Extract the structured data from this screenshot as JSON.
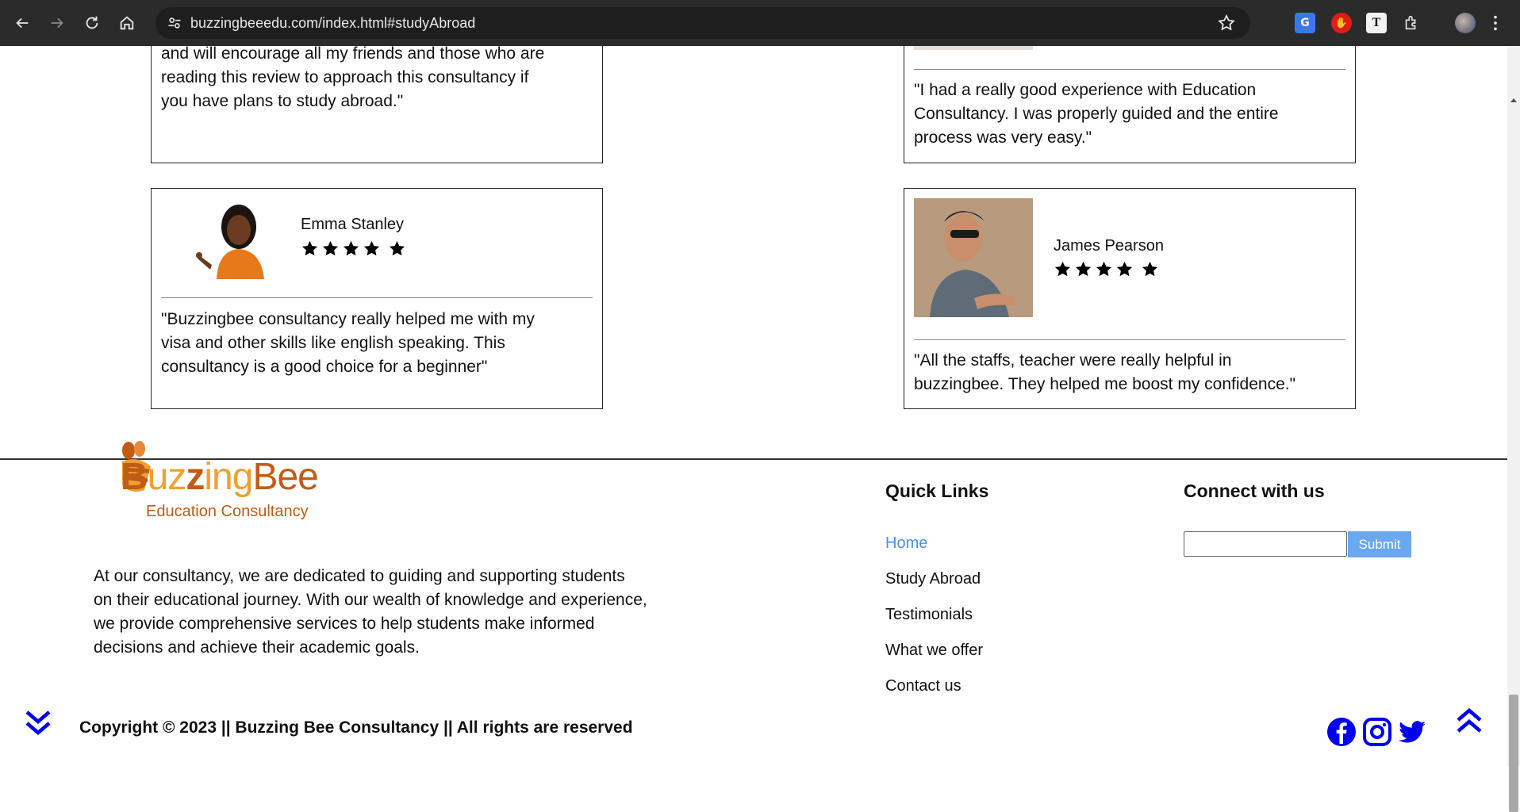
{
  "browser": {
    "url": "buzzingbeeedu.com/index.html#studyAbroad"
  },
  "testimonials": {
    "top_left_quote": [
      "and will encourage all my friends and those who are",
      "reading this review to approach this consultancy if",
      "you have plans to study abroad.\""
    ],
    "top_right_quote": [
      "\"I had a really good experience with Education",
      "Consultancy. I was properly guided and the entire",
      "process was very easy.\""
    ],
    "emma": {
      "name": "Emma Stanley",
      "quote": [
        "\"Buzzingbee consultancy really helped me with my",
        "visa and other skills like english speaking. This",
        "consultancy is a good choice for a beginner\""
      ],
      "rating": 5
    },
    "james": {
      "name": "James Pearson",
      "quote": [
        "\"All the staffs, teacher were really helpful in",
        "buzzingbee. They helped me boost my confidence.\""
      ],
      "rating": 5
    }
  },
  "footer": {
    "logo_text": "BuzzingBee",
    "logo_subtitle": "Education Consultancy",
    "about": [
      "At our consultancy, we are dedicated to guiding and supporting students",
      "on their educational journey. With our wealth of knowledge and experience,",
      "we provide comprehensive services to help students make informed",
      "decisions and achieve their academic goals."
    ],
    "quick_links_title": "Quick Links",
    "quick_links": [
      "Home",
      "Study Abroad",
      "Testimonials",
      "What we offer",
      "Contact us"
    ],
    "connect_title": "Connect with us",
    "submit_label": "Submit",
    "copyright": "Copyright © 2023 || Buzzing Bee Consultancy || All rights are reserved"
  },
  "colors": {
    "accent_link": "#4a90e2",
    "social_blue": "#0000ee",
    "logo_orange": "#f0a030",
    "logo_brown": "#c25b14"
  },
  "icons": [
    "back-arrow-icon",
    "forward-arrow-icon",
    "reload-icon",
    "home-icon",
    "site-settings-icon",
    "bookmark-star-icon",
    "translate-icon",
    "adblock-icon",
    "text-extension-icon",
    "extensions-puzzle-icon",
    "profile-avatar-icon",
    "more-menu-icon",
    "facebook-icon",
    "instagram-icon",
    "twitter-icon",
    "scroll-down-chevron-icon",
    "scroll-up-chevron-icon"
  ]
}
